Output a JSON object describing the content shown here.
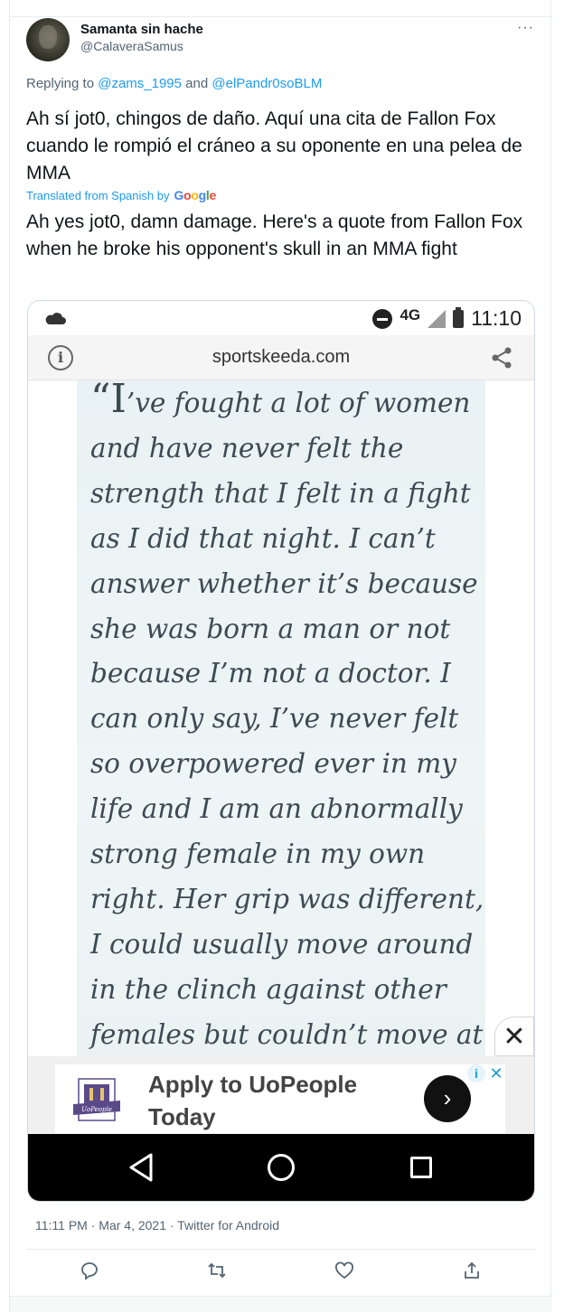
{
  "tweet": {
    "display_name": "Samanta sin hache",
    "handle": "@CalaveraSamus",
    "more_label": "···",
    "replying_prefix": "Replying to",
    "reply_mention_1": "@zams_1995",
    "reply_and": "and",
    "reply_mention_2": "@elPandr0soBLM",
    "text": "Ah sí jot0, chingos de daño. Aquí una cita de Fallon Fox cuando le rompió el cráneo a su oponente en una pelea de MMA",
    "translated_label": "Translated from Spanish by",
    "translator": "Google",
    "translation": "Ah yes jot0, damn damage. Here's a quote from Fallon Fox when he broke his opponent's skull in an MMA fight",
    "timestamp": "11:11 PM · Mar 4, 2021 · Twitter for Android"
  },
  "screenshot": {
    "network": "4G",
    "clock": "11:10",
    "url": "sportskeeda.com",
    "quote_open": "“I",
    "quote_rest": "’ve fought a lot of women and have never felt the strength that I felt in a fight as I did that night. I can’t answer whether it’s because she was born a man or not because I’m not a doctor. I can only say, I’ve never felt so overpowered ever in my life and I am an abnormally strong female in my own right. Her grip was different, I could usually move around in the clinch against other females but couldn’t move at",
    "close_label": "✕",
    "ad": {
      "logo_text": "UoPeople",
      "headline": "Apply to UoPeople Today",
      "go_label": "›",
      "choices_info": "i",
      "choices_close": "✕"
    }
  },
  "colors": {
    "link": "#1d9bf0",
    "secondary_text": "#536471",
    "quote_text": "#3d4a52"
  }
}
